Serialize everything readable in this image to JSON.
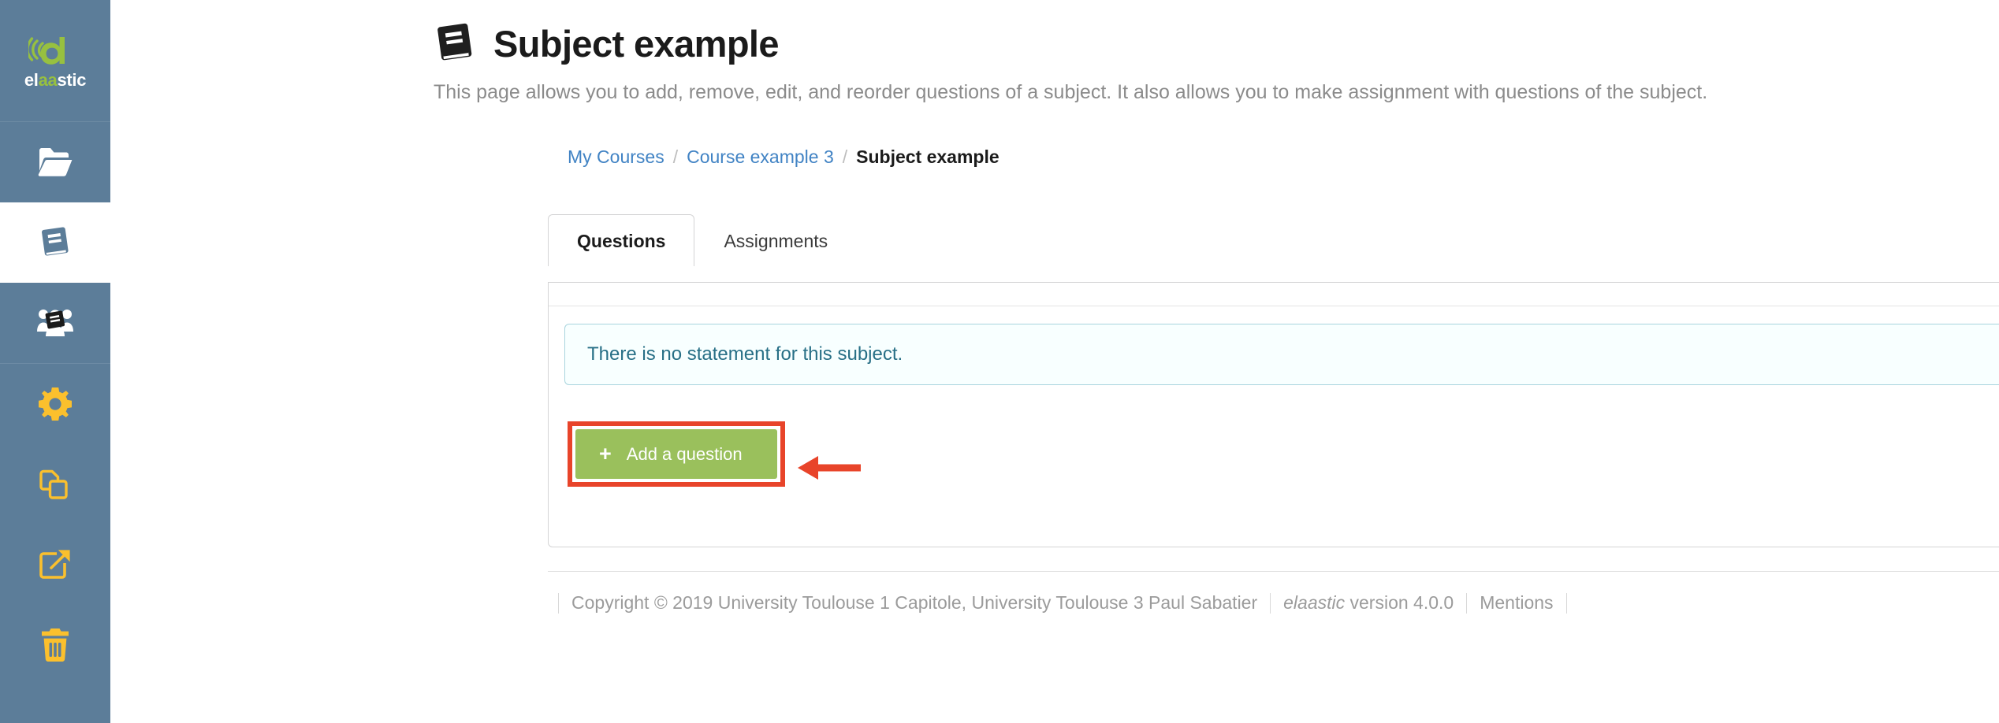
{
  "sidebar": {
    "logo": {
      "icon": "elaastic-logo-icon",
      "word_part1": "el",
      "word_part2": "aa",
      "word_part3": "stic",
      "brand_green": "#97c040",
      "background": "#5c7d99"
    },
    "items": [
      {
        "icon": "folder-open-icon",
        "name": "sidebar-item-courses",
        "active": false
      },
      {
        "icon": "book-icon",
        "name": "sidebar-item-subjects",
        "active": true
      },
      {
        "icon": "users-book-icon",
        "name": "sidebar-item-shared-subjects",
        "active": false
      },
      {
        "icon": "gear-icon",
        "name": "sidebar-item-settings",
        "active": false
      },
      {
        "icon": "copy-icon",
        "name": "sidebar-item-duplicate",
        "active": false
      },
      {
        "icon": "external-link-icon",
        "name": "sidebar-item-share",
        "active": false
      },
      {
        "icon": "trash-icon",
        "name": "sidebar-item-delete",
        "active": false
      }
    ]
  },
  "header": {
    "icon": "book-icon",
    "title": "Subject example",
    "description": "This page allows you to add, remove, edit, and reorder questions of a subject. It also allows you to make assignment with questions of the subject."
  },
  "breadcrumb": {
    "items": [
      {
        "label": "My Courses",
        "active": false
      },
      {
        "label": "Course example 3",
        "active": false
      },
      {
        "label": "Subject example",
        "active": true
      }
    ],
    "separator": "/"
  },
  "tabs": [
    {
      "label": "Questions",
      "active": true
    },
    {
      "label": "Assignments",
      "active": false
    }
  ],
  "panel": {
    "alert": {
      "text": "There is no statement for this subject.",
      "background": "#f8ffff",
      "border_color": "#a9d5de",
      "text_color": "#276f86"
    },
    "add_question_button": {
      "icon": "plus-icon",
      "label": "Add a question",
      "color": "#9ac05c"
    }
  },
  "annotation": {
    "highlight_color": "#e8442a",
    "arrow": "left-arrow-annotation",
    "target": "add-a-question-button"
  },
  "footer": {
    "copyright": "Copyright © 2019 University Toulouse 1 Capitole, University Toulouse 3 Paul Sabatier",
    "brand": "elaastic",
    "version": "version 4.0.0",
    "mentions": "Mentions"
  }
}
